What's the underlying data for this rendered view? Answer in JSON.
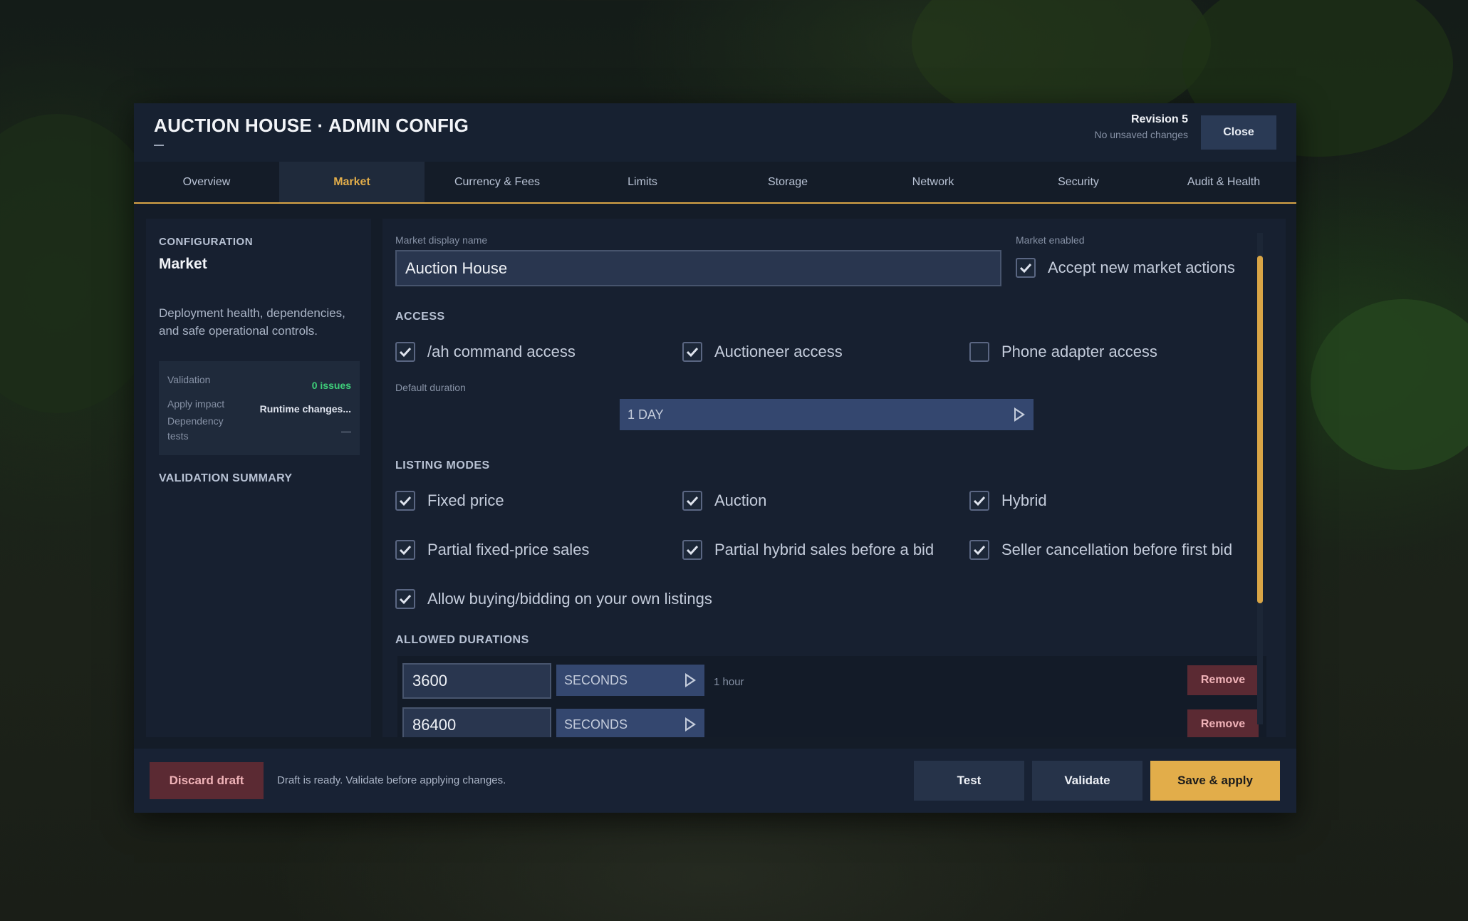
{
  "header": {
    "title": "AUCTION HOUSE · ADMIN CONFIG",
    "revision": "Revision 5",
    "revision_status": "No unsaved changes",
    "close_label": "Close"
  },
  "tabs": [
    {
      "label": "Overview"
    },
    {
      "label": "Market",
      "active": true
    },
    {
      "label": "Currency & Fees"
    },
    {
      "label": "Limits"
    },
    {
      "label": "Storage"
    },
    {
      "label": "Network"
    },
    {
      "label": "Security"
    },
    {
      "label": "Audit & Health"
    }
  ],
  "sidebar": {
    "heading": "CONFIGURATION",
    "title": "Market",
    "description": "Deployment health, dependencies, and safe operational controls.",
    "validation_label": "Validation",
    "validation_value": "0 issues",
    "apply_impact_label": "Apply impact",
    "apply_impact_value": "Runtime changes...",
    "dependency_label": "Dependency tests",
    "dependency_value": "—",
    "summary_heading": "VALIDATION SUMMARY"
  },
  "main": {
    "display_name_label": "Market display name",
    "display_name_value": "Auction House",
    "market_enabled_label": "Market enabled",
    "accept_actions_label": "Accept new market actions",
    "access_heading": "ACCESS",
    "access": [
      {
        "label": "/ah command access",
        "checked": true
      },
      {
        "label": "Auctioneer access",
        "checked": true
      },
      {
        "label": "Phone adapter access",
        "checked": false
      }
    ],
    "default_duration_label": "Default duration",
    "default_duration_value": "1 DAY",
    "listing_heading": "LISTING MODES",
    "listing_modes": [
      {
        "label": "Fixed price",
        "checked": true
      },
      {
        "label": "Auction",
        "checked": true
      },
      {
        "label": "Hybrid",
        "checked": true
      },
      {
        "label": "Partial fixed-price sales",
        "checked": true
      },
      {
        "label": "Partial hybrid sales before a bid",
        "checked": true
      },
      {
        "label": "Seller cancellation before first bid",
        "checked": true
      },
      {
        "label": "Allow buying/bidding on your own listings",
        "checked": true
      }
    ],
    "durations_heading": "ALLOWED DURATIONS",
    "durations": [
      {
        "value": "3600",
        "unit": "SECONDS",
        "hint": "1 hour",
        "remove_label": "Remove"
      },
      {
        "value": "86400",
        "unit": "SECONDS",
        "hint": "",
        "remove_label": "Remove"
      }
    ]
  },
  "footer": {
    "discard_label": "Discard draft",
    "status": "Draft is ready. Validate before applying changes.",
    "test_label": "Test",
    "validate_label": "Validate",
    "save_label": "Save & apply"
  },
  "colors": {
    "accent": "#e2ad4a",
    "success": "#3ecf7a",
    "danger": "#5b2a33",
    "panel": "#141c28"
  }
}
